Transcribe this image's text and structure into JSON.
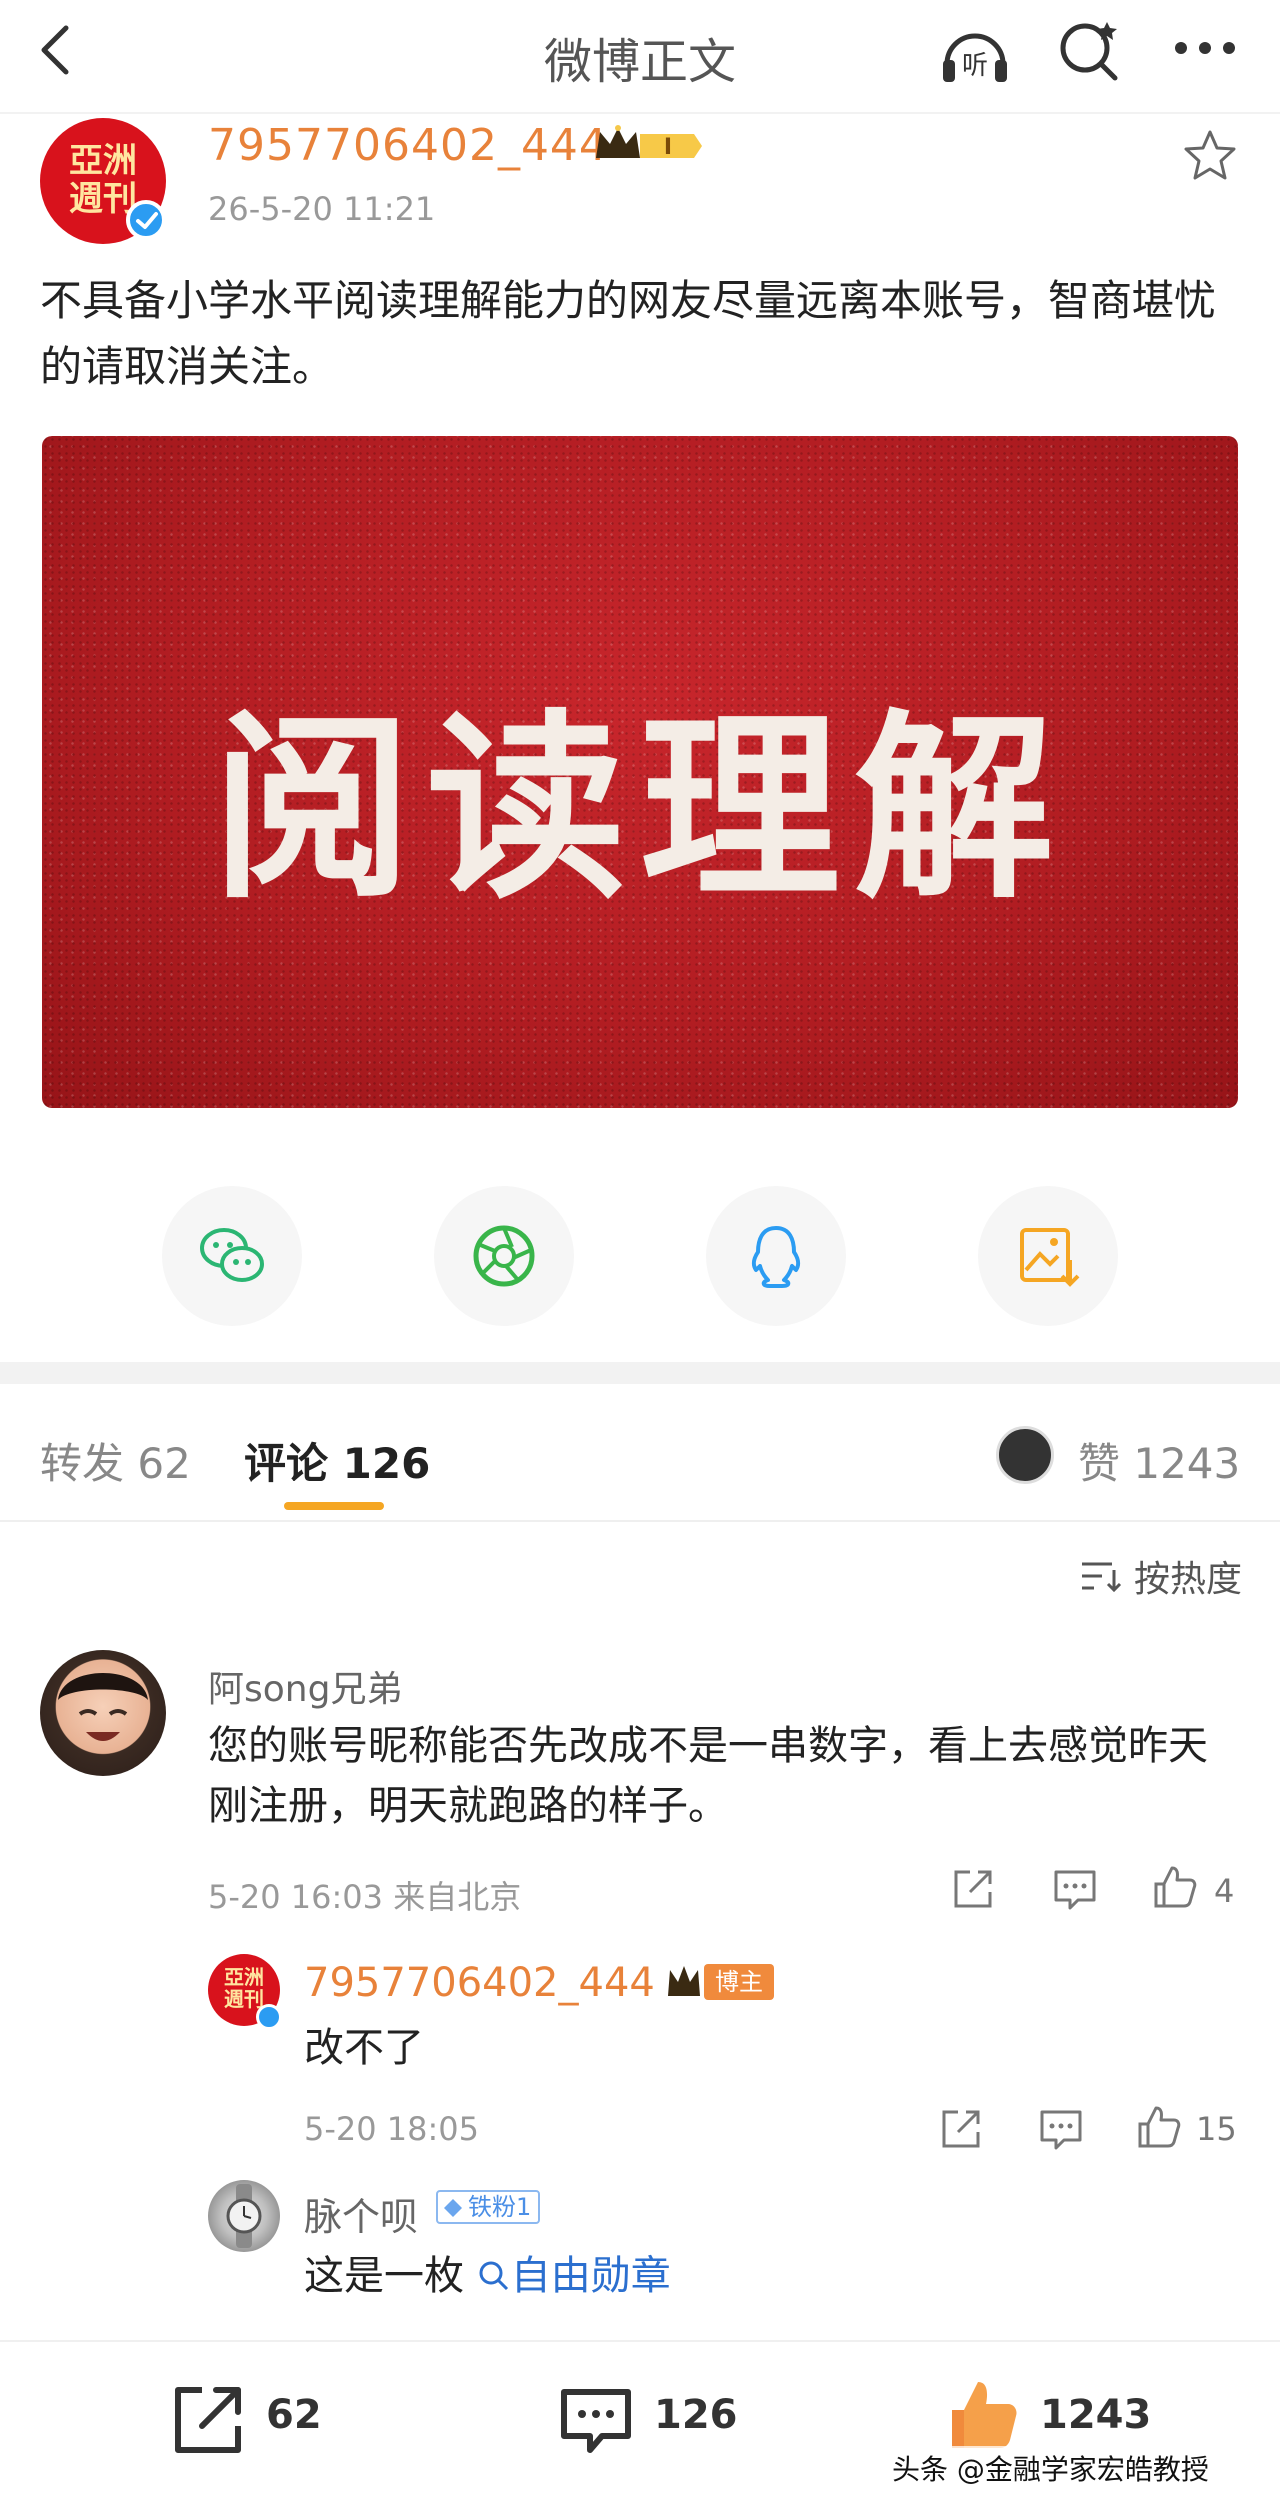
{
  "nav": {
    "title": "微博正文",
    "listen_label": "听"
  },
  "post": {
    "avatar_text": "亞洲週刊",
    "username": "7957706402_444",
    "level_badge": "I",
    "time": "26-5-20 11:21",
    "text": "不具备小学水平阅读理解能力的网友尽量远离本账号，智商堪忧的请取消关注。",
    "image_text": "阅读理解"
  },
  "share_icons": [
    "wechat-icon",
    "moments-icon",
    "qq-icon",
    "save-image-icon"
  ],
  "tabs": {
    "repost": "转发 62",
    "comments": "评论 126",
    "likes": "赞 1243"
  },
  "sort_label": "按热度",
  "comments": [
    {
      "name": "阿song兄弟",
      "text": "您的账号昵称能否先改成不是一串数字，看上去感觉昨天刚注册，明天就跑路的样子。",
      "time": "5-20 16:03 来自北京",
      "likes": "4",
      "reply": {
        "avatar_text": "亞洲週刊",
        "name": "7957706402_444",
        "badge": "博主",
        "text": "改不了",
        "time": "5-20 18:05",
        "likes": "15"
      }
    },
    {
      "name": "脉个呗",
      "badge": "铁粉1",
      "text_prefix": "这是一枚",
      "search_tag": "自由勋章"
    }
  ],
  "bottom_bar": {
    "repost_count": "62",
    "comment_count": "126",
    "like_count": "1243"
  },
  "watermark": "头条 @金融学家宏皓教授",
  "colors": {
    "accent": "#f5a623",
    "username": "#e8823a",
    "verified": "#2b9cf2",
    "image_red": "#b21d22"
  }
}
